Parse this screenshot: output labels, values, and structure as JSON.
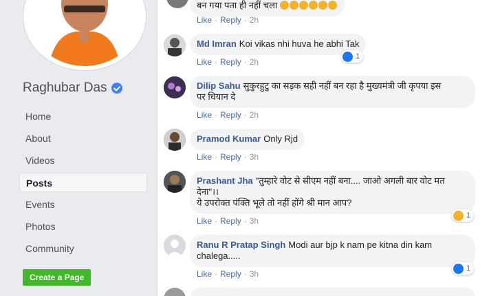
{
  "sidebar": {
    "page_name": "Raghubar Das",
    "nav": [
      "Home",
      "About",
      "Videos",
      "Posts",
      "Events",
      "Photos",
      "Community"
    ],
    "active_nav": "Posts",
    "create_page_label": "Create a Page"
  },
  "colors": {
    "link": "#385898",
    "action_link": "#4267b2",
    "button_green": "#42b72a",
    "verified_blue": "#4080ff"
  },
  "comments": [
    {
      "author": "",
      "text": "बन गया पता ही नहीं चला",
      "like": "Like",
      "reply": "Reply",
      "time": "2h",
      "emojis": 6
    },
    {
      "author": "Md Imran",
      "text": "Koi vikas nhi huva he abhi Tak",
      "like": "Like",
      "reply": "Reply",
      "time": "2h",
      "reaction": "like",
      "reaction_count": "1"
    },
    {
      "author": "Dilip Sahu",
      "text": "सुकुरहुटु का सड़क सही नहीं बन रहा है मुख्यमंत्री जी कृपया इस",
      "text2": "पर धियान दे",
      "like": "Like",
      "reply": "Reply",
      "time": "2h"
    },
    {
      "author": "Pramod Kumar",
      "text": "Only Rjd",
      "like": "Like",
      "reply": "Reply",
      "time": "3h"
    },
    {
      "author": "Prashant Jha",
      "text": "\"तुम्हारे वोट से सीएम नहीं बना.... जाओ अगली बार वोट मत",
      "text2": "देना\"।।",
      "text3": "ये उपरोक्त पंक्ति भूले तो नहीं होंगे श्री मान आप?",
      "like": "Like",
      "reply": "Reply",
      "time": "3h",
      "reaction": "haha",
      "reaction_count": "1"
    },
    {
      "author": "Ranu R Pratap Singh",
      "text": "Modi aur bjp k nam pe kitna din kam",
      "text2": "chalega.....",
      "like": "Like",
      "reply": "Reply",
      "time": "3h",
      "reaction": "like",
      "reaction_count": "1"
    }
  ]
}
